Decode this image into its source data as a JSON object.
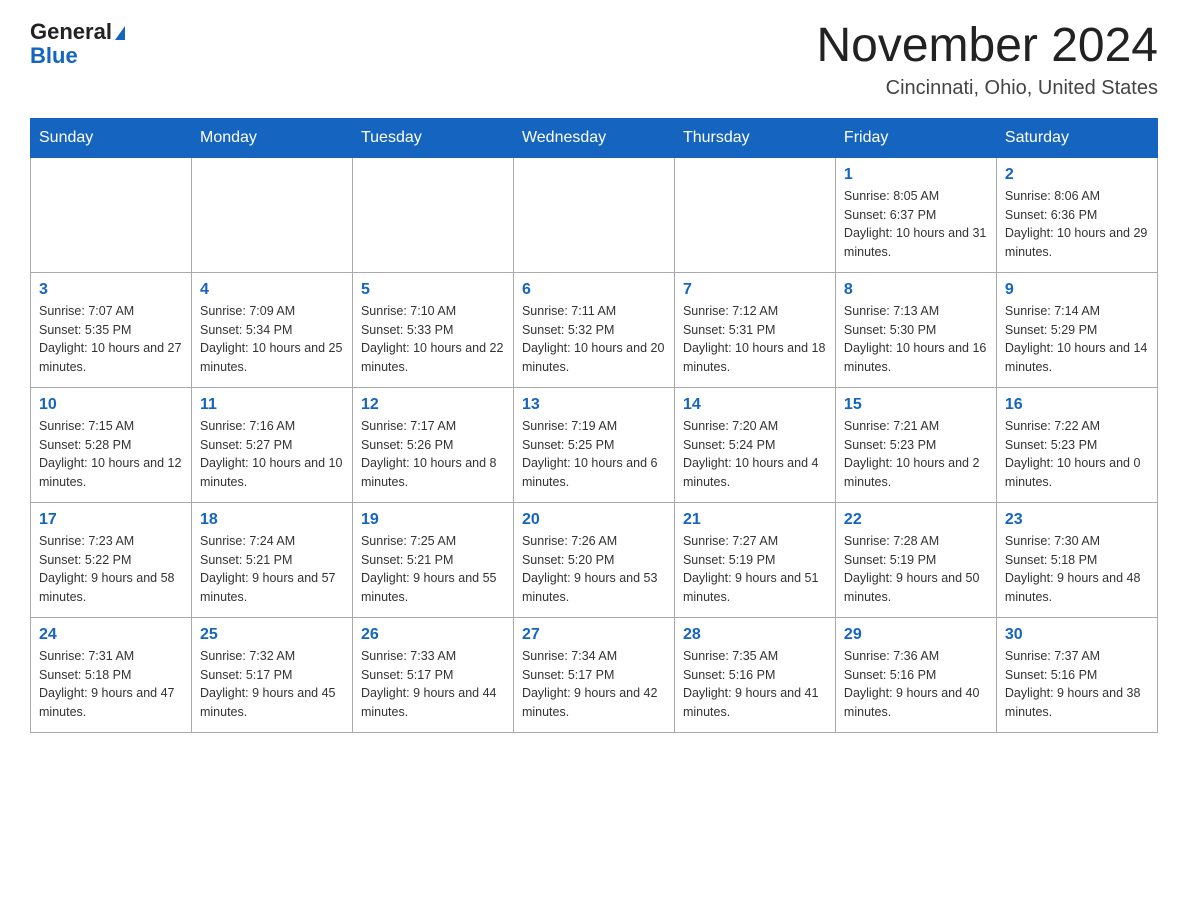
{
  "logo": {
    "general": "General",
    "blue": "Blue"
  },
  "title": "November 2024",
  "location": "Cincinnati, Ohio, United States",
  "days_of_week": [
    "Sunday",
    "Monday",
    "Tuesday",
    "Wednesday",
    "Thursday",
    "Friday",
    "Saturday"
  ],
  "weeks": [
    [
      {
        "day": "",
        "info": ""
      },
      {
        "day": "",
        "info": ""
      },
      {
        "day": "",
        "info": ""
      },
      {
        "day": "",
        "info": ""
      },
      {
        "day": "",
        "info": ""
      },
      {
        "day": "1",
        "info": "Sunrise: 8:05 AM\nSunset: 6:37 PM\nDaylight: 10 hours and 31 minutes."
      },
      {
        "day": "2",
        "info": "Sunrise: 8:06 AM\nSunset: 6:36 PM\nDaylight: 10 hours and 29 minutes."
      }
    ],
    [
      {
        "day": "3",
        "info": "Sunrise: 7:07 AM\nSunset: 5:35 PM\nDaylight: 10 hours and 27 minutes."
      },
      {
        "day": "4",
        "info": "Sunrise: 7:09 AM\nSunset: 5:34 PM\nDaylight: 10 hours and 25 minutes."
      },
      {
        "day": "5",
        "info": "Sunrise: 7:10 AM\nSunset: 5:33 PM\nDaylight: 10 hours and 22 minutes."
      },
      {
        "day": "6",
        "info": "Sunrise: 7:11 AM\nSunset: 5:32 PM\nDaylight: 10 hours and 20 minutes."
      },
      {
        "day": "7",
        "info": "Sunrise: 7:12 AM\nSunset: 5:31 PM\nDaylight: 10 hours and 18 minutes."
      },
      {
        "day": "8",
        "info": "Sunrise: 7:13 AM\nSunset: 5:30 PM\nDaylight: 10 hours and 16 minutes."
      },
      {
        "day": "9",
        "info": "Sunrise: 7:14 AM\nSunset: 5:29 PM\nDaylight: 10 hours and 14 minutes."
      }
    ],
    [
      {
        "day": "10",
        "info": "Sunrise: 7:15 AM\nSunset: 5:28 PM\nDaylight: 10 hours and 12 minutes."
      },
      {
        "day": "11",
        "info": "Sunrise: 7:16 AM\nSunset: 5:27 PM\nDaylight: 10 hours and 10 minutes."
      },
      {
        "day": "12",
        "info": "Sunrise: 7:17 AM\nSunset: 5:26 PM\nDaylight: 10 hours and 8 minutes."
      },
      {
        "day": "13",
        "info": "Sunrise: 7:19 AM\nSunset: 5:25 PM\nDaylight: 10 hours and 6 minutes."
      },
      {
        "day": "14",
        "info": "Sunrise: 7:20 AM\nSunset: 5:24 PM\nDaylight: 10 hours and 4 minutes."
      },
      {
        "day": "15",
        "info": "Sunrise: 7:21 AM\nSunset: 5:23 PM\nDaylight: 10 hours and 2 minutes."
      },
      {
        "day": "16",
        "info": "Sunrise: 7:22 AM\nSunset: 5:23 PM\nDaylight: 10 hours and 0 minutes."
      }
    ],
    [
      {
        "day": "17",
        "info": "Sunrise: 7:23 AM\nSunset: 5:22 PM\nDaylight: 9 hours and 58 minutes."
      },
      {
        "day": "18",
        "info": "Sunrise: 7:24 AM\nSunset: 5:21 PM\nDaylight: 9 hours and 57 minutes."
      },
      {
        "day": "19",
        "info": "Sunrise: 7:25 AM\nSunset: 5:21 PM\nDaylight: 9 hours and 55 minutes."
      },
      {
        "day": "20",
        "info": "Sunrise: 7:26 AM\nSunset: 5:20 PM\nDaylight: 9 hours and 53 minutes."
      },
      {
        "day": "21",
        "info": "Sunrise: 7:27 AM\nSunset: 5:19 PM\nDaylight: 9 hours and 51 minutes."
      },
      {
        "day": "22",
        "info": "Sunrise: 7:28 AM\nSunset: 5:19 PM\nDaylight: 9 hours and 50 minutes."
      },
      {
        "day": "23",
        "info": "Sunrise: 7:30 AM\nSunset: 5:18 PM\nDaylight: 9 hours and 48 minutes."
      }
    ],
    [
      {
        "day": "24",
        "info": "Sunrise: 7:31 AM\nSunset: 5:18 PM\nDaylight: 9 hours and 47 minutes."
      },
      {
        "day": "25",
        "info": "Sunrise: 7:32 AM\nSunset: 5:17 PM\nDaylight: 9 hours and 45 minutes."
      },
      {
        "day": "26",
        "info": "Sunrise: 7:33 AM\nSunset: 5:17 PM\nDaylight: 9 hours and 44 minutes."
      },
      {
        "day": "27",
        "info": "Sunrise: 7:34 AM\nSunset: 5:17 PM\nDaylight: 9 hours and 42 minutes."
      },
      {
        "day": "28",
        "info": "Sunrise: 7:35 AM\nSunset: 5:16 PM\nDaylight: 9 hours and 41 minutes."
      },
      {
        "day": "29",
        "info": "Sunrise: 7:36 AM\nSunset: 5:16 PM\nDaylight: 9 hours and 40 minutes."
      },
      {
        "day": "30",
        "info": "Sunrise: 7:37 AM\nSunset: 5:16 PM\nDaylight: 9 hours and 38 minutes."
      }
    ]
  ]
}
